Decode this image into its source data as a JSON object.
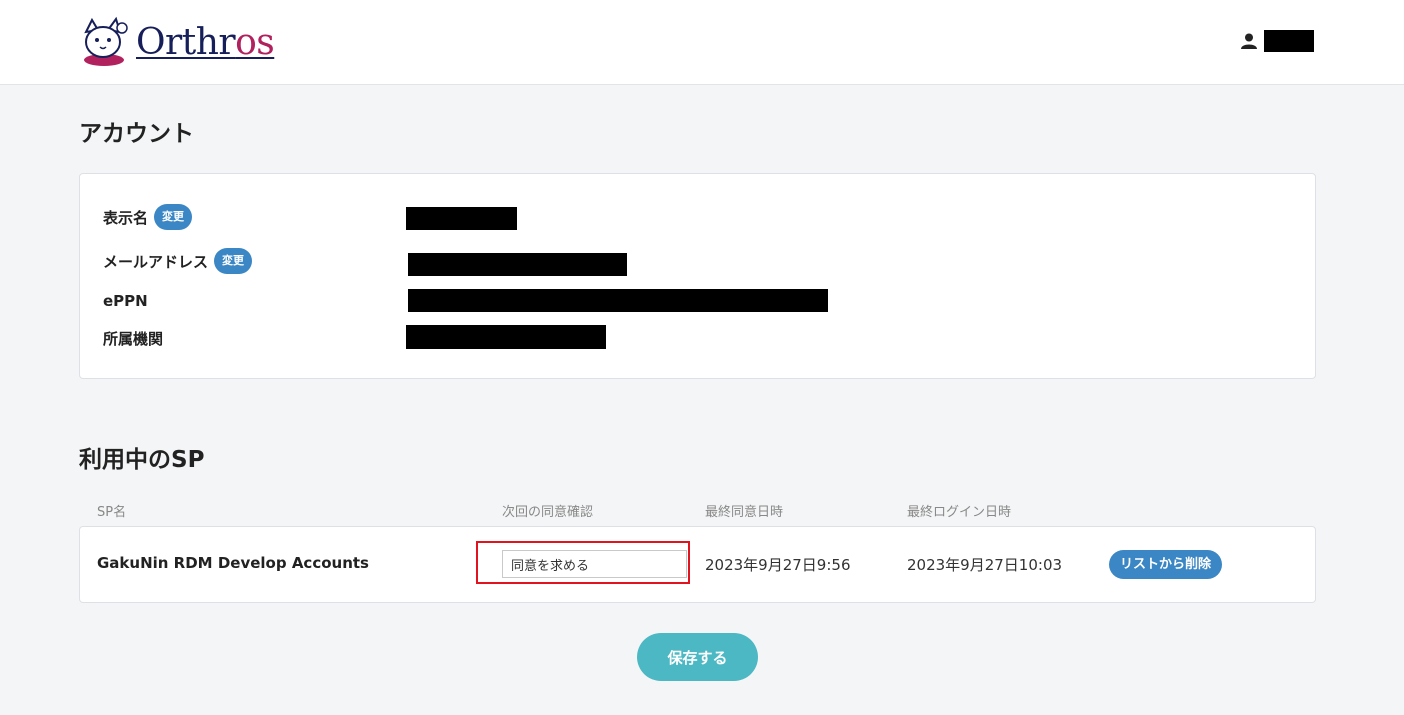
{
  "header": {
    "brand": "Orthros",
    "brand_main": "Orthr",
    "brand_accent": "os",
    "user_icon": "user-icon"
  },
  "account": {
    "title": "アカウント",
    "fields": [
      {
        "label": "表示名",
        "badge": "変更"
      },
      {
        "label": "メールアドレス",
        "badge": "変更"
      },
      {
        "label": "ePPN"
      },
      {
        "label": "所属機関"
      }
    ]
  },
  "sp": {
    "title": "利用中のSP",
    "columns": [
      "SP名",
      "次回の同意確認",
      "最終同意日時",
      "最終ログイン日時"
    ],
    "rows": [
      {
        "name": "GakuNin RDM Develop Accounts",
        "consent": "同意を求める",
        "last_consent": "2023年9月27日9:56",
        "last_login": "2023年9月27日10:03",
        "remove_label": "リストから削除"
      }
    ]
  },
  "save_label": "保存する",
  "colors": {
    "brand_navy": "#161f5a",
    "brand_magenta": "#b0215e",
    "badge_blue": "#3b86c4",
    "save_teal": "#4cb8c4",
    "highlight_red": "#e2131f"
  }
}
